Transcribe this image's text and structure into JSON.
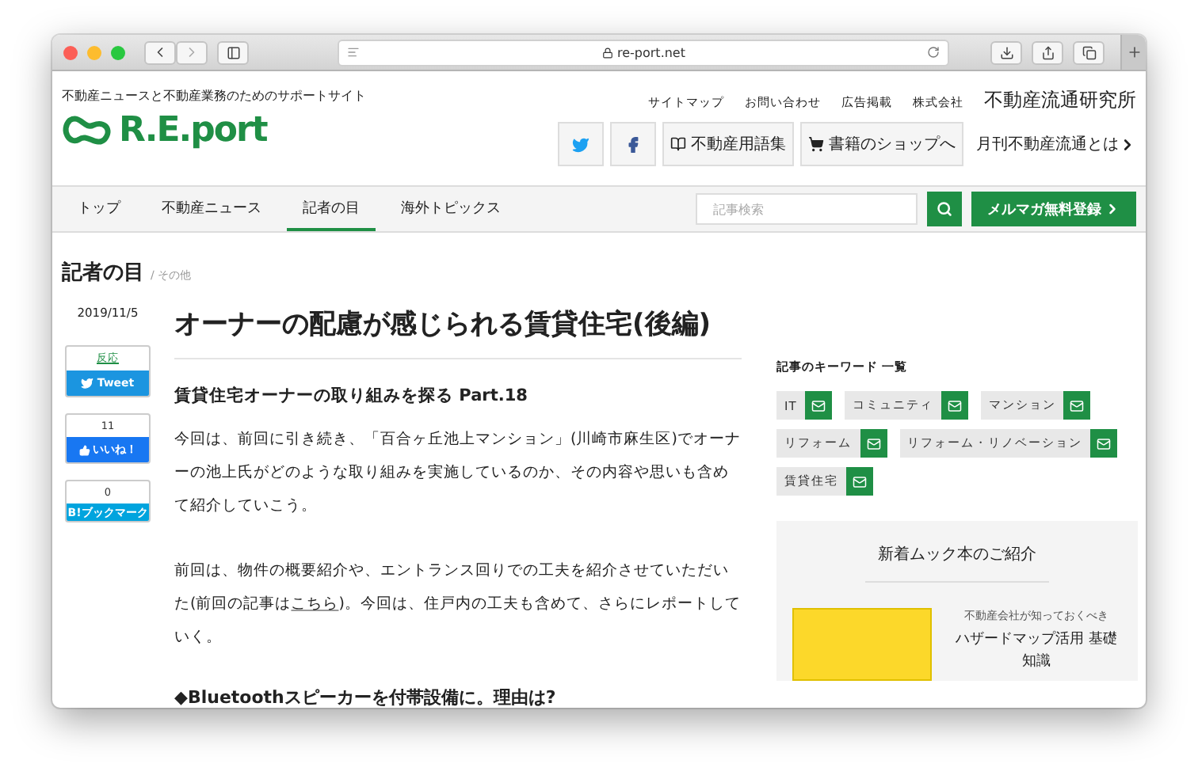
{
  "browser": {
    "url": "re-port.net"
  },
  "header": {
    "tagline": "不動産ニュースと不動産業務のためのサポートサイト",
    "logo": "R.E.port",
    "links": [
      "サイトマップ",
      "お問い合わせ",
      "広告掲載"
    ],
    "company_prefix": "株式会社",
    "company": "不動産流通研究所",
    "buttons": [
      {
        "kind": "twitter"
      },
      {
        "kind": "facebook"
      },
      {
        "kind": "book",
        "label": "不動産用語集"
      },
      {
        "kind": "cart",
        "label": "書籍のショップへ"
      }
    ],
    "magazine_link": "月刊不動産流通とは"
  },
  "nav": {
    "tabs": [
      {
        "label": "トップ",
        "selected": false
      },
      {
        "label": "不動産ニュース",
        "selected": false
      },
      {
        "label": "記者の目",
        "selected": true
      },
      {
        "label": "海外トピックス",
        "selected": false
      }
    ],
    "search": {
      "placeholder": "記事検索"
    },
    "newsletter_button": "メルマガ無料登録"
  },
  "breadcrumb": {
    "section": "記者の目",
    "sub": "/ その他"
  },
  "share": {
    "date": "2019/11/5",
    "tweet": {
      "label": "反応",
      "button": "Tweet"
    },
    "like": {
      "count": "11",
      "button": "いいね！"
    },
    "bookmark": {
      "count": "0",
      "button": "B!ブックマーク"
    }
  },
  "article": {
    "title": "オーナーの配慮が感じられる賃貸住宅(後編)",
    "subtitle": "賃貸住宅オーナーの取り組みを探る Part.18",
    "paragraphs": [
      [
        {
          "kind": "text",
          "text": " 今回は、前回に引き続き、「百合ヶ丘池上マンション」(川崎市麻生区)でオーナーの池上氏がどのような取り組みを実施しているのか、その内容や思いも含めて紹介していこう。"
        }
      ],
      [
        {
          "kind": "text",
          "text": " 前回は、物件の概要紹介や、エントランス回りでの工夫を紹介させていただいた(前回の記事は"
        },
        {
          "kind": "link",
          "text": "こちら"
        },
        {
          "kind": "text",
          "text": ")。今回は、住戸内の工夫も含めて、さらにレポートしていく。"
        }
      ]
    ],
    "heading": "◆Bluetoothスピーカーを付帯設備に。理由は?"
  },
  "sidebar": {
    "keywords_title": "記事のキーワード 一覧",
    "keywords": [
      "IT",
      "コミュニティ",
      "マンション",
      "リフォーム",
      "リフォーム・リノベーション",
      "賃貸住宅"
    ],
    "mook": {
      "title": "新着ムック本のご紹介",
      "book_note": "不動産会社が知っておくべき",
      "book_title": "ハザードマップ活用 基礎知識"
    }
  }
}
